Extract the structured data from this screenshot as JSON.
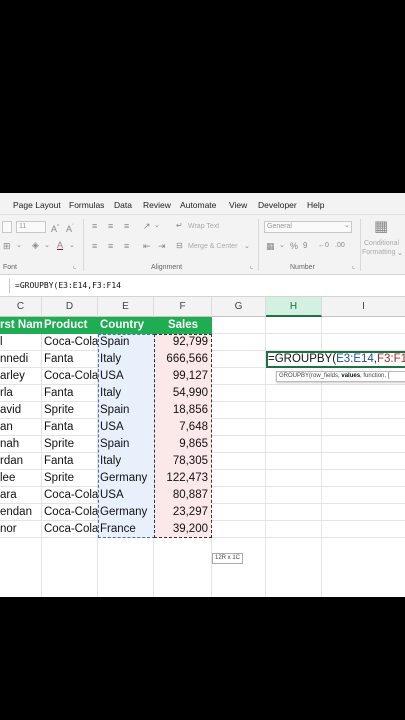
{
  "menu": [
    "Page Layout",
    "Formulas",
    "Data",
    "Review",
    "Automate",
    "View",
    "Developer",
    "Help"
  ],
  "ribbon": {
    "font_size": "11",
    "number_format": "General",
    "wrap_text": "Wrap Text",
    "merge_center": "Merge & Center",
    "conditional_formatting_1": "Conditional",
    "conditional_formatting_2": "Formatting",
    "groups": {
      "font": "Font",
      "alignment": "Alignment",
      "number": "Number"
    }
  },
  "formula_bar": {
    "text": "=GROUPBY(E3:E14,F3:F14"
  },
  "columns": [
    {
      "label": "C"
    },
    {
      "label": "D"
    },
    {
      "label": "E"
    },
    {
      "label": "F"
    },
    {
      "label": "G"
    },
    {
      "label": "H"
    },
    {
      "label": "I"
    }
  ],
  "table": {
    "headers": [
      "rst Nam",
      "Product",
      "Country",
      "Sales"
    ],
    "rows": [
      [
        "l",
        "Coca-Cola",
        "Spain",
        "92,799"
      ],
      [
        "nnedi",
        "Fanta",
        "Italy",
        "666,566"
      ],
      [
        "arley",
        "Coca-Cola",
        "USA",
        "99,127"
      ],
      [
        "rla",
        "Fanta",
        "Italy",
        "54,990"
      ],
      [
        "avid",
        "Sprite",
        "Spain",
        "18,856"
      ],
      [
        "an",
        "Fanta",
        "USA",
        "7,648"
      ],
      [
        "nah",
        "Sprite",
        "Spain",
        "9,865"
      ],
      [
        "rdan",
        "Fanta",
        "Italy",
        "78,305"
      ],
      [
        "lee",
        "Sprite",
        "Germany",
        "122,473"
      ],
      [
        "ara",
        "Coca-Cola",
        "USA",
        "80,887"
      ],
      [
        "endan",
        "Coca-Cola",
        "Germany",
        "23,297"
      ],
      [
        "nor",
        "Coca-Cola",
        "France",
        "39,200"
      ]
    ]
  },
  "active_cell": {
    "fn": "=GROUPBY(",
    "ref1": "E3:E14",
    "comma": ",",
    "ref2": "F3:F14"
  },
  "tooltip": {
    "fn": "GROUPBY(row_fields, ",
    "bold": "values",
    "rest": ", function, ["
  },
  "size_badge": "12R x 1C",
  "colors": {
    "header_green": "#1fad53",
    "excel_green": "#1e7145",
    "ref_blue": "#1f4e9c",
    "ref_red": "#a12a2a"
  }
}
